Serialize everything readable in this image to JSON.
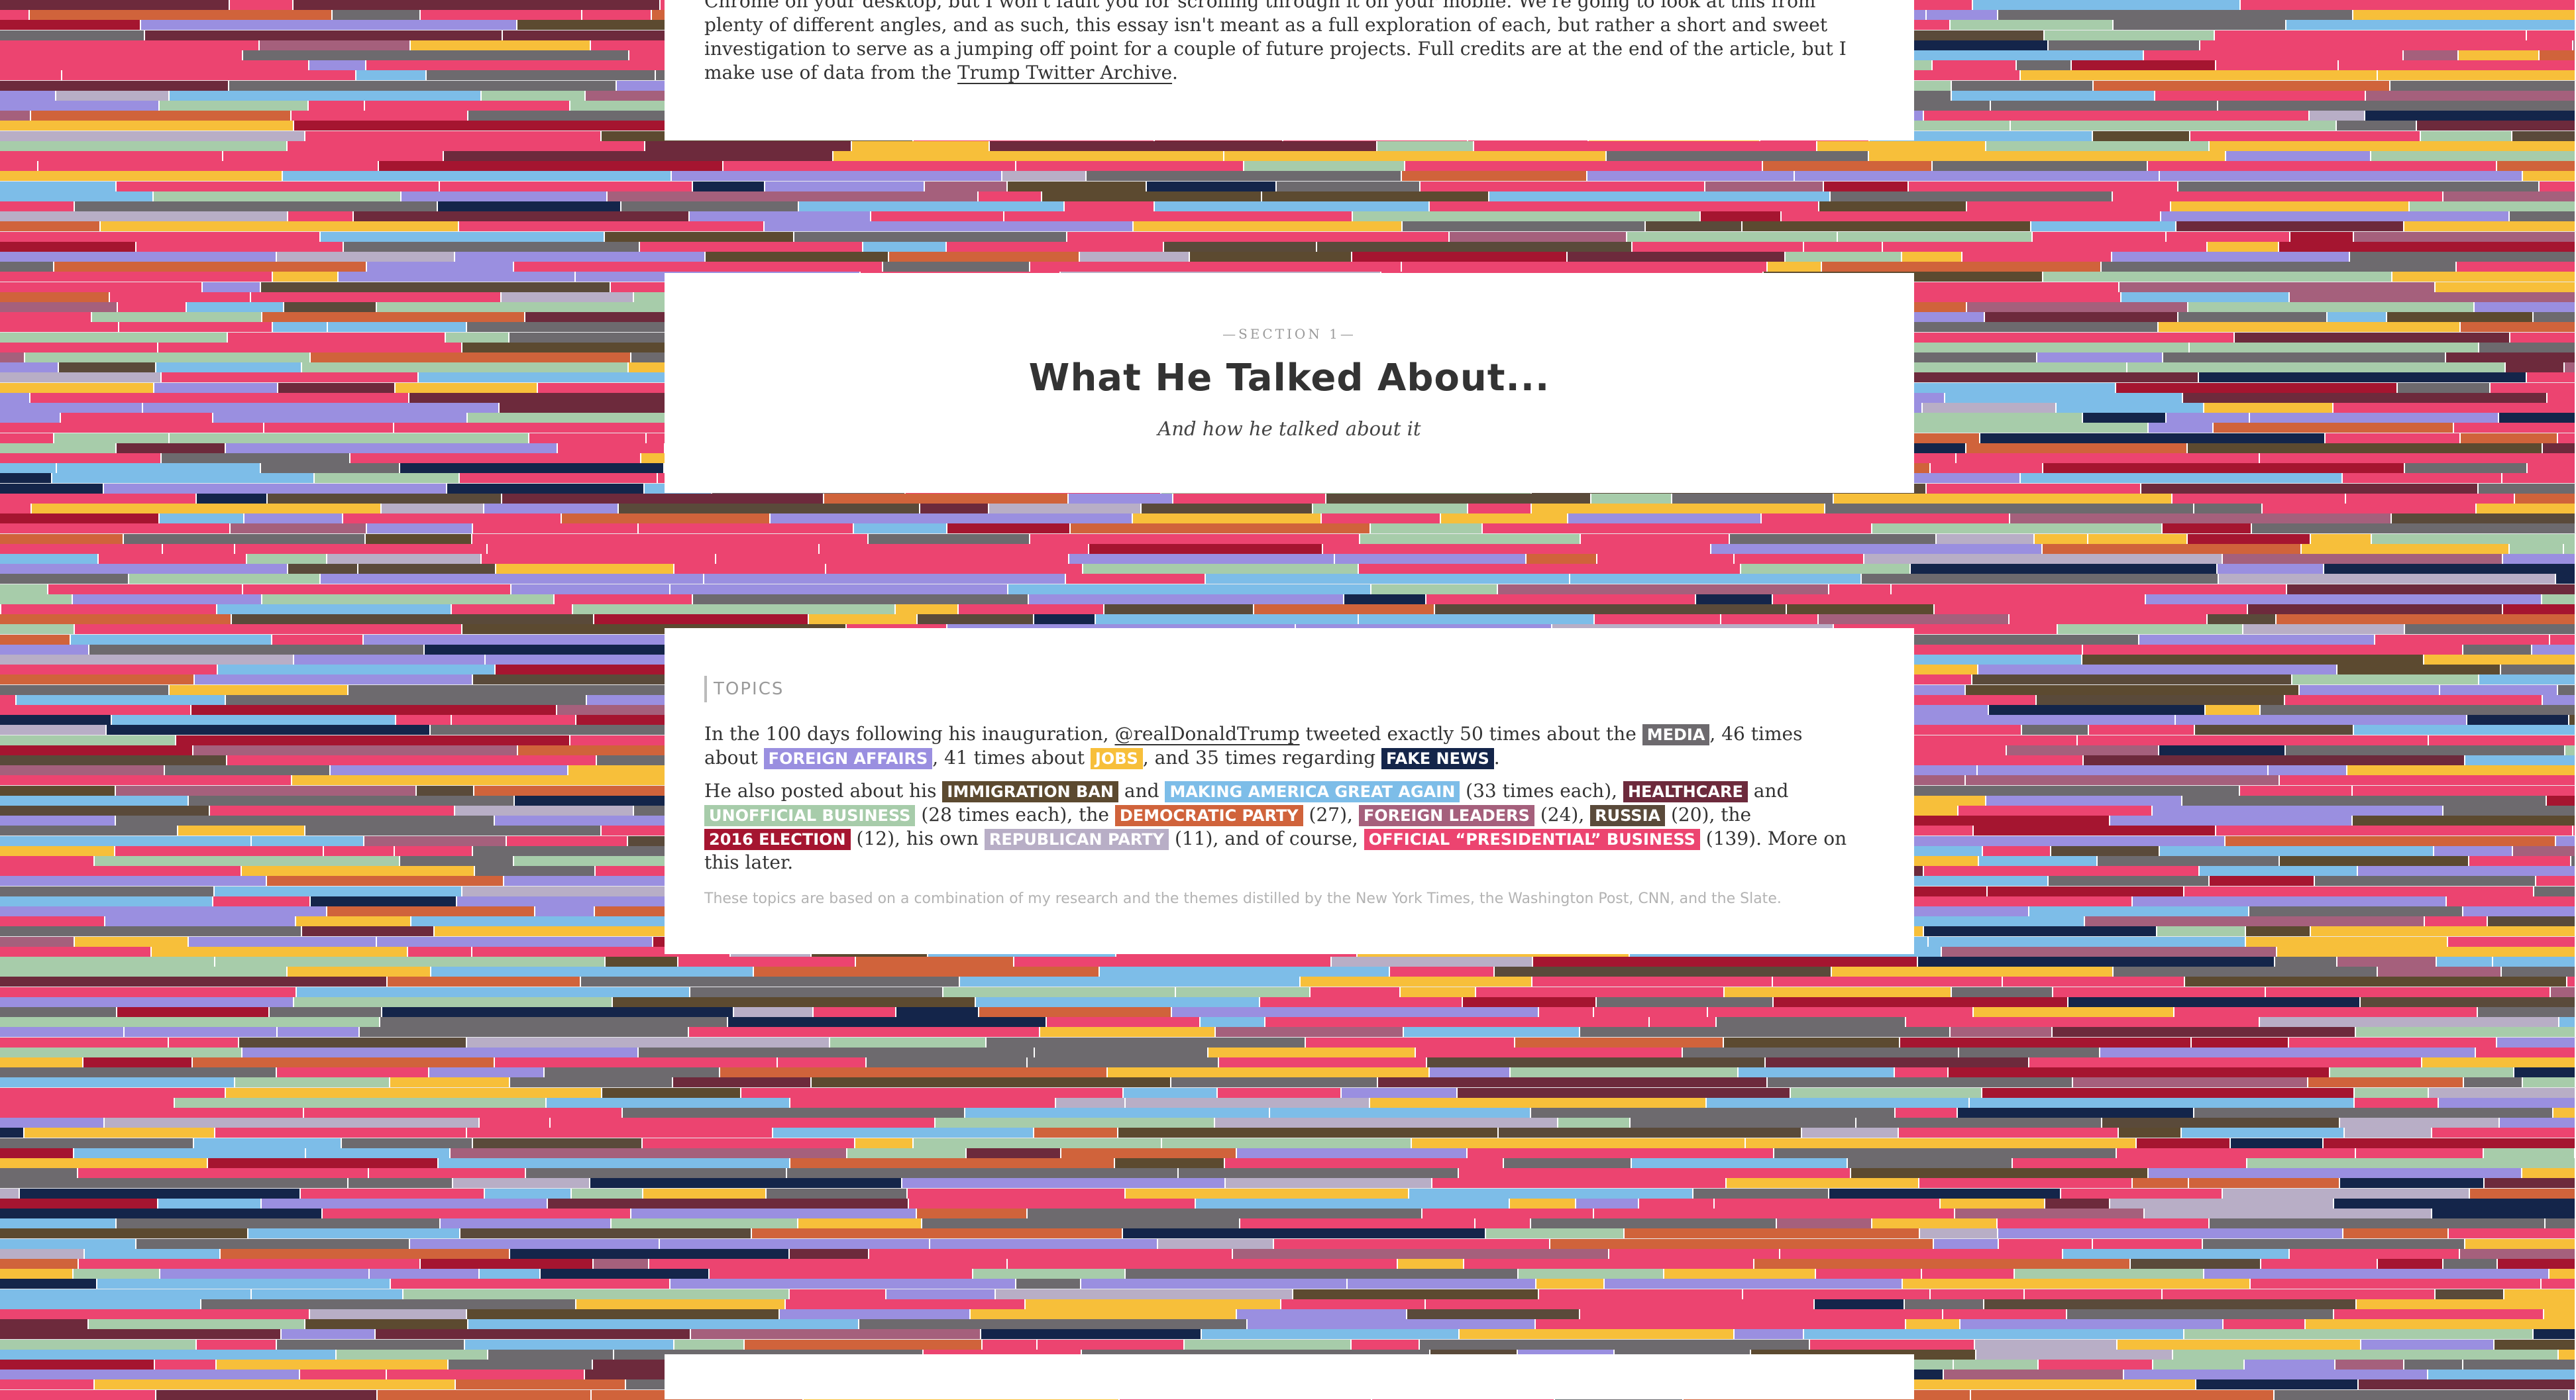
{
  "colors": {
    "media": "#6d6a6e",
    "foreign_affairs": "#9a8fe0",
    "jobs": "#f7bf3a",
    "fake_news": "#14254a",
    "immigration_ban": "#5c4a30",
    "maga": "#7dbde8",
    "healthcare": "#6d2a3c",
    "unofficial_business": "#a7ccaa",
    "democratic_party": "#d0633b",
    "foreign_leaders": "#a5607c",
    "russia": "#5a4a3a",
    "election_2016": "#a51530",
    "republican_party": "#b8aec6",
    "official_business": "#ec4470"
  },
  "intro": {
    "text": "Chrome on your desktop, but I won't fault you for scrolling through it on your mobile. We're going to look at this from plenty of different angles, and as such, this essay isn't meant as a full exploration of each, but rather a short and sweet investigation to serve as a jumping off point for a couple of future projects. Full credits are at the end of the article, but I make use of data from the ",
    "link": "Trump Twitter Archive",
    "end": "."
  },
  "section": {
    "kicker": "—SECTION 1—",
    "title": "What He Talked About...",
    "subtitle": "And how he talked about it"
  },
  "topics": {
    "label": "TOPICS",
    "p1": {
      "a": "In the 100 days following his inauguration, ",
      "handle": "@realDonaldTrump",
      "b": " tweeted exactly 50 times about the ",
      "t_media": "MEDIA",
      "c": ", 46 times about ",
      "t_foreign": "FOREIGN AFFAIRS",
      "d": ", 41 times about ",
      "t_jobs": "JOBS",
      "e": ", and 35 times regarding ",
      "t_fake": "FAKE NEWS",
      "f": "."
    },
    "p2": {
      "a": "He also posted about his ",
      "t_immigration": "IMMIGRATION BAN",
      "b": " and ",
      "t_maga": "MAKING AMERICA GREAT AGAIN",
      "c": " (33 times each), ",
      "t_health": "HEALTHCARE",
      "d": " and ",
      "t_unofficial": "UNOFFICIAL BUSINESS",
      "e": " (28 times each), the ",
      "t_dem": "DEMOCRATIC PARTY",
      "f": " (27), ",
      "t_leaders": "FOREIGN LEADERS",
      "g": " (24), ",
      "t_russia": "RUSSIA",
      "h": " (20), the ",
      "t_election": "2016 ELECTION",
      "i": " (12), his own ",
      "t_rep": "REPUBLICAN PARTY",
      "j": " (11), and of course, ",
      "t_official": "OFFICIAL “PRESIDENTIAL” BUSINESS",
      "k": " (139). More on this later."
    },
    "note": "These topics are based on a combination of my research and the themes distilled by the New York Times, the Washington Post, CNN, and the Slate."
  }
}
